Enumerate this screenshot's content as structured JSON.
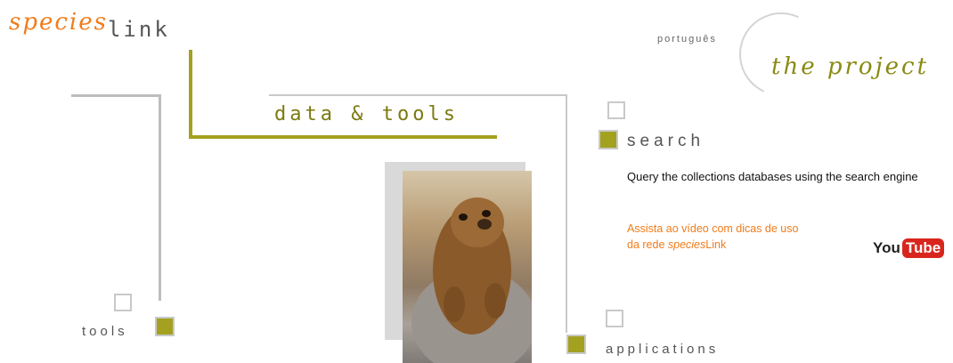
{
  "logo": {
    "species": "species",
    "link": "link"
  },
  "header": {
    "language_link": "português",
    "project_link": "the project"
  },
  "nav": {
    "data_tools": "data & tools",
    "search": "search",
    "tools": "tools",
    "applications": "applications"
  },
  "search_panel": {
    "description": "Query the collections databases using the search engine",
    "video_line1": "Assista ao vídeo com dicas de uso",
    "video_line2_prefix": "da rede ",
    "video_line2_italic": "species",
    "video_line2_suffix": "Link",
    "youtube_you": "You",
    "youtube_tube": "Tube"
  },
  "colors": {
    "accent_olive": "#a3a11f",
    "orange": "#f07c1a",
    "gray": "#bdbdbd"
  },
  "icons": {
    "photo": "marmot-photo"
  }
}
